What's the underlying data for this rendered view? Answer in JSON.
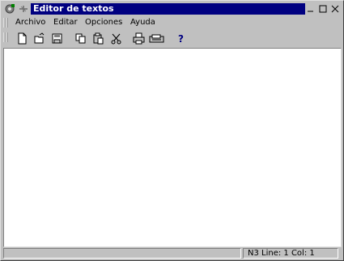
{
  "window": {
    "title": "Editor de textos",
    "system_icon": "app-icon",
    "pin_icon": "pin-icon",
    "controls": [
      "minimize-icon",
      "maximize-icon",
      "close-icon"
    ]
  },
  "menubar": {
    "items": [
      {
        "label": "Archivo"
      },
      {
        "label": "Editar"
      },
      {
        "label": "Opciones"
      },
      {
        "label": "Ayuda"
      }
    ]
  },
  "toolbar": {
    "buttons": [
      "new-document-icon",
      "open-icon",
      "save-icon",
      "copy-icon",
      "paste-icon",
      "cut-icon",
      "print-icon",
      "print-preview-icon",
      "help-icon"
    ]
  },
  "editor": {
    "content": ""
  },
  "statusbar": {
    "text": "N3  Line: 1 Col: 1"
  }
}
